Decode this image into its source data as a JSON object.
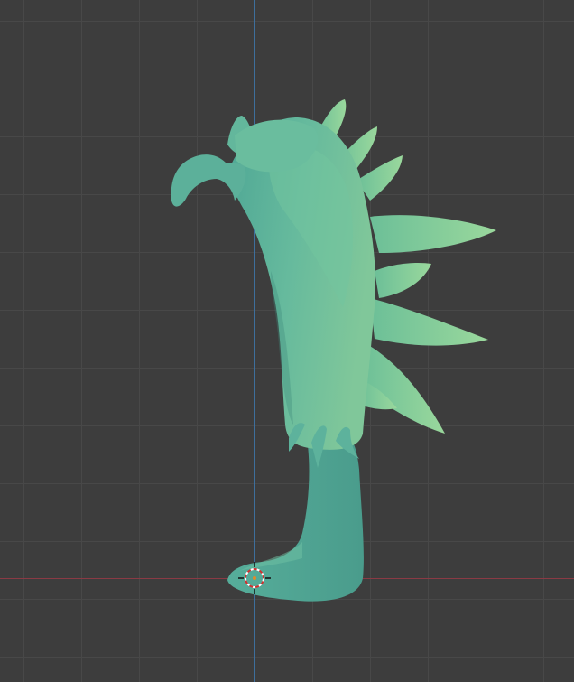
{
  "viewport": {
    "background_color": "#3d3d3d",
    "grid_color": "#484848",
    "x_axis_color": "#8a3a44",
    "z_axis_color": "#3e6f9c"
  },
  "object": {
    "icon": "sculpted-creature-mesh",
    "base_color": "#5fb59b",
    "highlight_color": "#86cf9a",
    "shadow_color": "#3f8a7a"
  },
  "cursor": {
    "icon": "3d-cursor-icon"
  }
}
